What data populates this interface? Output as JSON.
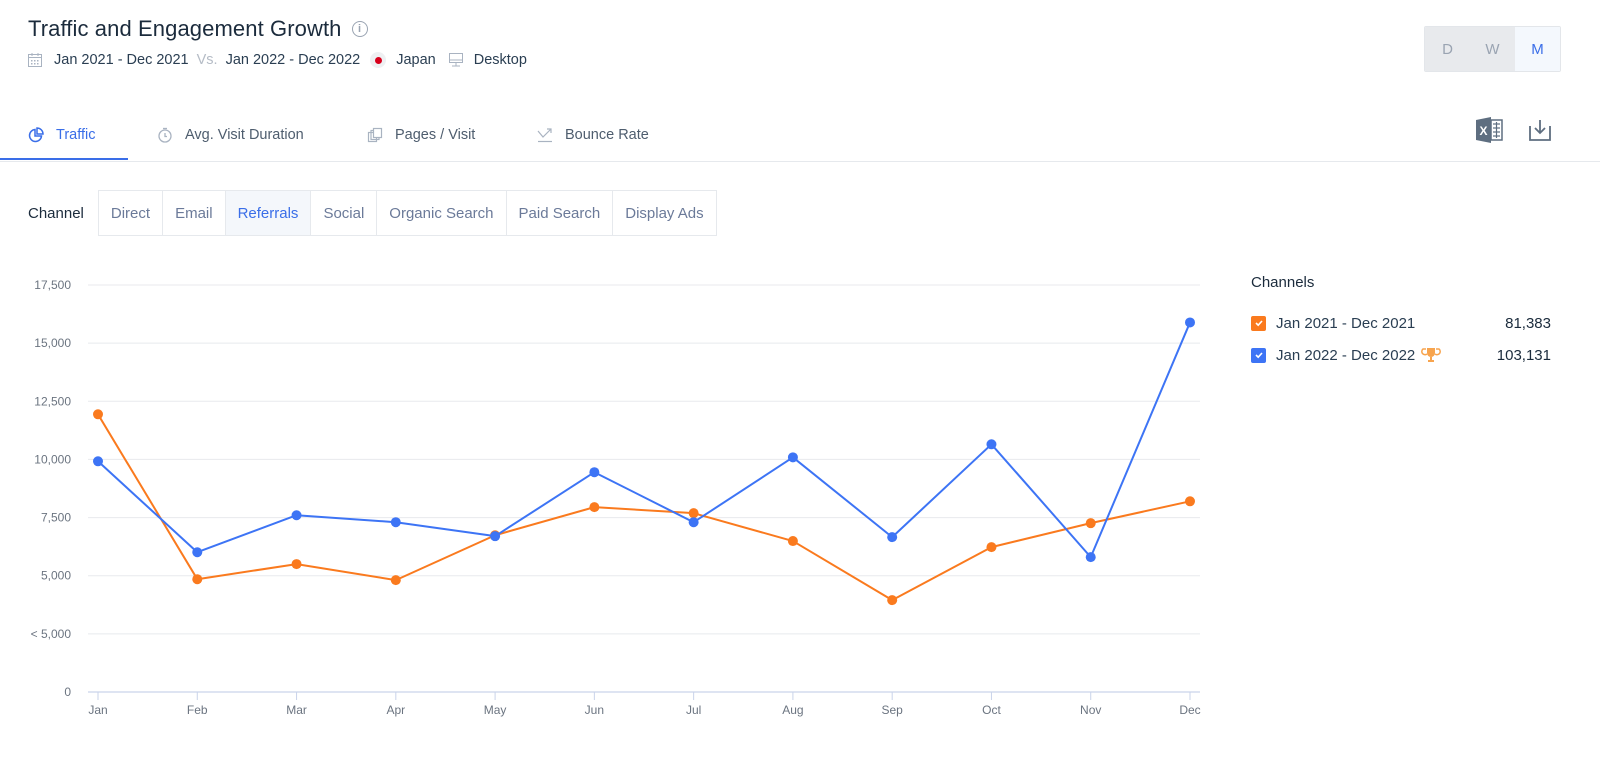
{
  "header": {
    "title": "Traffic and Engagement Growth",
    "period_a": "Jan 2021 - Dec 2021",
    "vs_label": "Vs.",
    "period_b": "Jan 2022 - Dec 2022",
    "country": "Japan",
    "device": "Desktop"
  },
  "granularity": {
    "options": [
      "D",
      "W",
      "M"
    ],
    "selected": "M"
  },
  "tabs": [
    {
      "label": "Traffic",
      "icon": "pie-chart-icon",
      "active": true
    },
    {
      "label": "Avg. Visit Duration",
      "icon": "stopwatch-icon",
      "active": false
    },
    {
      "label": "Pages / Visit",
      "icon": "pages-icon",
      "active": false
    },
    {
      "label": "Bounce Rate",
      "icon": "bounce-icon",
      "active": false
    }
  ],
  "toolbar": {
    "excel_icon": "excel-export-icon",
    "download_icon": "download-icon"
  },
  "channel": {
    "label": "Channel",
    "options": [
      "Direct",
      "Email",
      "Referrals",
      "Social",
      "Organic Search",
      "Paid Search",
      "Display Ads"
    ],
    "selected": "Referrals"
  },
  "legend": {
    "title": "Channels",
    "items": [
      {
        "label": "Jan 2021 - Dec 2021",
        "value": "81,383",
        "color": "#fa7a1e",
        "checked": true,
        "winner": false
      },
      {
        "label": "Jan 2022 - Dec 2022",
        "value": "103,131",
        "color": "#3d74f5",
        "checked": true,
        "winner": true
      }
    ]
  },
  "chart_data": {
    "type": "line",
    "title": "",
    "xlabel": "",
    "ylabel": "",
    "categories": [
      "Jan",
      "Feb",
      "Mar",
      "Apr",
      "May",
      "Jun",
      "Jul",
      "Aug",
      "Sep",
      "Oct",
      "Nov",
      "Dec"
    ],
    "y_ticks": [
      0,
      2500,
      5000,
      7500,
      10000,
      12500,
      15000,
      17500
    ],
    "y_tick_labels": [
      "0",
      "< 5,000",
      "5,000",
      "7,500",
      "10,000",
      "12,500",
      "15,000",
      "17,500"
    ],
    "ylim": [
      0,
      17500
    ],
    "grid": true,
    "legend_position": "right",
    "series": [
      {
        "name": "Jan 2021 - Dec 2021",
        "color": "#fa7a1e",
        "values": [
          11940,
          4850,
          5500,
          4810,
          6740,
          7950,
          7690,
          6490,
          3950,
          6230,
          7260,
          8200
        ]
      },
      {
        "name": "Jan 2022 - Dec 2022",
        "color": "#3d74f5",
        "values": [
          9920,
          6010,
          7600,
          7300,
          6700,
          9450,
          7300,
          10090,
          6660,
          10650,
          5800,
          15890
        ]
      }
    ]
  }
}
